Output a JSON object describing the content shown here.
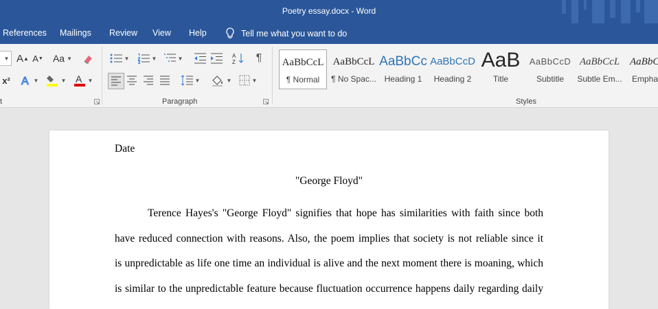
{
  "window": {
    "title": "Poetry essay.docx  -  Word"
  },
  "menu": {
    "tabs": [
      "References",
      "Mailings",
      "Review",
      "View",
      "Help"
    ],
    "tell_me": "Tell me what you want to do"
  },
  "ribbon": {
    "groups": {
      "paragraph": "Paragraph",
      "styles": "Styles",
      "font_partial": "t"
    },
    "font": {
      "change_case": "Aa",
      "grow": "A",
      "shrink": "A",
      "superscript": "x²"
    },
    "styles": [
      {
        "sample": "AaBbCcL",
        "name": "¶ Normal"
      },
      {
        "sample": "AaBbCcL",
        "name": "¶ No Spac..."
      },
      {
        "sample": "AaBbCc",
        "name": "Heading 1"
      },
      {
        "sample": "AaBbCcD",
        "name": "Heading 2"
      },
      {
        "sample": "AaB",
        "name": "Title"
      },
      {
        "sample": "AaBbCcD",
        "name": "Subtitle"
      },
      {
        "sample": "AaBbCcL",
        "name": "Subtle Em..."
      },
      {
        "sample": "AaBbC",
        "name": "Empha"
      }
    ]
  },
  "document": {
    "date": "Date",
    "title": "\"George Floyd\"",
    "lines": [
      "Terence Hayes's \"George Floyd\" signifies that hope has similarities with faith since both",
      "have reduced connection with reasons. Also, the poem implies that society is not reliable since it",
      "is unpredictable as life one time an individual is alive and the next moment there is moaning, which",
      "is similar to the unpredictable feature because fluctuation occurrence happens daily regarding daily"
    ]
  },
  "colors": {
    "accent": "#2b579a",
    "ribbon": "#f3f3f3",
    "canvas": "#e6e6e6"
  }
}
